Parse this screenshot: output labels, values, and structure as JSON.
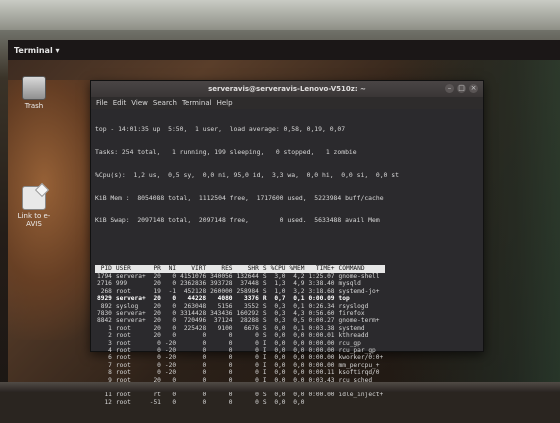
{
  "top_bar": {
    "app_menu": "Terminal ▾",
    "right_text": ""
  },
  "desktop": {
    "icons": [
      {
        "label": "Trash",
        "icon": "trash-icon"
      },
      {
        "label": "Link to e-AVIS",
        "icon": "file-link-icon"
      }
    ]
  },
  "terminal": {
    "title": "serveravis@serveravis-Lenovo-V510z: ~",
    "menu": [
      "File",
      "Edit",
      "View",
      "Search",
      "Terminal",
      "Help"
    ],
    "summary": [
      "top - 14:01:35 up  5:50,  1 user,  load average: 0,58, 0,19, 0,07",
      "Tasks: 254 total,   1 running, 199 sleeping,   0 stopped,   1 zombie",
      "%Cpu(s):  1,2 us,  0,5 sy,  0,0 ni, 95,0 id,  3,3 wa,  0,0 hi,  0,0 si,  0,0 st",
      "KiB Mem :  8054088 total,  1112504 free,  1717600 used,  5223984 buff/cache",
      "KiB Swap:  2097148 total,  2097148 free,        0 used.  5633488 avail Mem"
    ],
    "columns": [
      "PID",
      "USER",
      "PR",
      "NI",
      "VIRT",
      "RES",
      "SHR",
      "S",
      "%CPU",
      "%MEM",
      "TIME+",
      "COMMAND"
    ],
    "rows": [
      [
        "1794",
        "servera+",
        "20",
        "0",
        "4151076",
        "340056",
        "132644",
        "S",
        "3,0",
        "4,2",
        "1:25.07",
        "gnome-shell"
      ],
      [
        "2716",
        "999",
        "20",
        "0",
        "2362836",
        "393728",
        "37448",
        "S",
        "1,3",
        "4,9",
        "3:38.40",
        "mysqld"
      ],
      [
        "268",
        "root",
        "19",
        "-1",
        "452128",
        "260000",
        "258984",
        "S",
        "1,0",
        "3,2",
        "3:18.68",
        "systemd-jo+"
      ],
      [
        "8929",
        "servera+",
        "20",
        "0",
        "44228",
        "4080",
        "3376",
        "R",
        "0,7",
        "0,1",
        "0:00.09",
        "top"
      ],
      [
        "892",
        "syslog",
        "20",
        "0",
        "263048",
        "5156",
        "3552",
        "S",
        "0,3",
        "0,1",
        "0:26.34",
        "rsyslogd"
      ],
      [
        "7830",
        "servera+",
        "20",
        "0",
        "3314428",
        "343436",
        "160292",
        "S",
        "0,3",
        "4,3",
        "0:56.60",
        "firefox"
      ],
      [
        "8842",
        "servera+",
        "20",
        "0",
        "720496",
        "37124",
        "28288",
        "S",
        "0,3",
        "0,5",
        "0:00.27",
        "gnome-term+"
      ],
      [
        "1",
        "root",
        "20",
        "0",
        "225428",
        "9100",
        "6676",
        "S",
        "0,0",
        "0,1",
        "0:03.38",
        "systemd"
      ],
      [
        "2",
        "root",
        "20",
        "0",
        "0",
        "0",
        "0",
        "S",
        "0,0",
        "0,0",
        "0:00.01",
        "kthreadd"
      ],
      [
        "3",
        "root",
        "0",
        "-20",
        "0",
        "0",
        "0",
        "I",
        "0,0",
        "0,0",
        "0:00.00",
        "rcu_gp"
      ],
      [
        "4",
        "root",
        "0",
        "-20",
        "0",
        "0",
        "0",
        "I",
        "0,0",
        "0,0",
        "0:00.00",
        "rcu_par_gp"
      ],
      [
        "6",
        "root",
        "0",
        "-20",
        "0",
        "0",
        "0",
        "I",
        "0,0",
        "0,0",
        "0:00.00",
        "kworker/0:0+"
      ],
      [
        "7",
        "root",
        "0",
        "-20",
        "0",
        "0",
        "0",
        "I",
        "0,0",
        "0,0",
        "0:00.00",
        "mm_percpu_+"
      ],
      [
        "8",
        "root",
        "0",
        "-20",
        "0",
        "0",
        "0",
        "I",
        "0,0",
        "0,0",
        "0:00.11",
        "ksoftirqd/0"
      ],
      [
        "9",
        "root",
        "20",
        "0",
        "0",
        "0",
        "0",
        "I",
        "0,0",
        "0,0",
        "0:03.43",
        "rcu_sched"
      ],
      [
        "10",
        "root",
        "rt",
        "0",
        "0",
        "0",
        "0",
        "S",
        "0,0",
        "0,0",
        "0:00.09",
        "migration/0"
      ],
      [
        "11",
        "root",
        "rt",
        "0",
        "0",
        "0",
        "0",
        "S",
        "0,0",
        "0,0",
        "0:00.00",
        "idle_inject+"
      ],
      [
        "12",
        "root",
        "-51",
        "0",
        "0",
        "0",
        "0",
        "S",
        "0,0",
        "0,0",
        "",
        ""
      ]
    ],
    "highlight_pid": "8929"
  }
}
